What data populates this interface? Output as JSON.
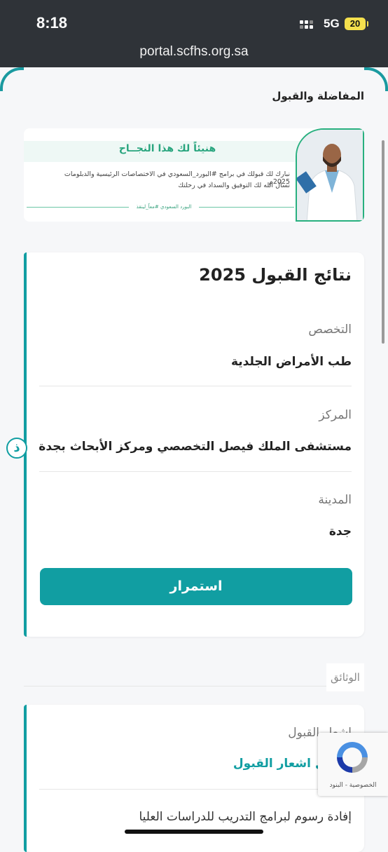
{
  "status_bar": {
    "time": "8:18",
    "network": "5G",
    "battery": "20",
    "url": "portal.scfhs.org.sa"
  },
  "section": {
    "title": "المفاضلة والقبول"
  },
  "banner": {
    "title": "هنيئاً لك هذا النجــاح",
    "line1": "نبارك لك قبولك في برامج #البورد_السعودي في الاختصاصات الرئيسية والدبلومات 2025م",
    "line2": "نسأل الله لك التوفيق والسداد في رحلتك",
    "tag": "البورد السعودي #معاً_لينقذ"
  },
  "results": {
    "title": "نتائج القبول 2025",
    "specialty_label": "التخصص",
    "specialty_value": "طب الأمراض الجلدية",
    "center_label": "المركز",
    "center_value": "مستشفى الملك فيصل التخصصي ومركز الأبحاث بجدة",
    "city_label": "المدينة",
    "city_value": "جدة",
    "continue_label": "استمرار"
  },
  "float_button": {
    "icon": "accessibility-icon",
    "glyph": "ذ"
  },
  "documents": {
    "label": "الوثائق",
    "acceptance_label": "اشعار القبول",
    "download_link": "تحميل اشعار القبول",
    "fees_line": "إفادة رسوم لبرامج التدريب للدراسات العليا"
  },
  "recaptcha": {
    "text": "الخصوصية - البنود"
  },
  "colors": {
    "accent": "#119ea2",
    "banner_green": "#28a57e",
    "status_bg": "#2f3338"
  }
}
